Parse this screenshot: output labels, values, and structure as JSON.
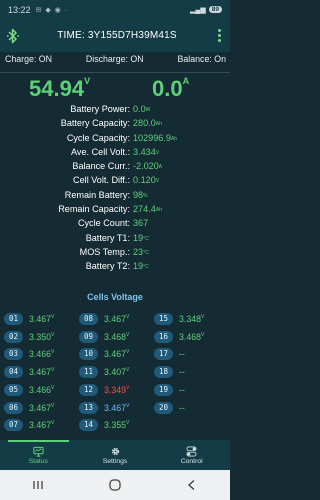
{
  "status_bar": {
    "time": "13:22",
    "battery": "89"
  },
  "app_bar": {
    "title": "TIME: 3Y155D7H39M41S"
  },
  "modes": {
    "charge_label": "Charge:",
    "charge_value": "ON",
    "discharge_label": "Discharge:",
    "discharge_value": "ON",
    "balance_label": "Balance:",
    "balance_value": "On"
  },
  "summary": {
    "voltage": "54.94",
    "voltage_unit": "V",
    "current": "0.0",
    "current_unit": "A"
  },
  "params": [
    {
      "label": "Battery Power:",
      "value": "0.0",
      "unit": "W"
    },
    {
      "label": "Battery Capacity:",
      "value": "280.0",
      "unit": "Ah"
    },
    {
      "label": "Cycle Capacity:",
      "value": "102996.9",
      "unit": "Ah"
    },
    {
      "label": "Ave. Cell Volt.:",
      "value": "3.434",
      "unit": "V"
    },
    {
      "label": "Balance Curr.:",
      "value": "-2.020",
      "unit": "A"
    },
    {
      "label": "Cell Volt. Diff.:",
      "value": "0.120",
      "unit": "V"
    },
    {
      "label": "Remain Battery:",
      "value": "98",
      "unit": "%"
    },
    {
      "label": "Remain Capacity:",
      "value": "274.4",
      "unit": "Ah"
    },
    {
      "label": "Cycle Count:",
      "value": "367",
      "unit": ""
    },
    {
      "label": "Battery T1:",
      "value": "19",
      "unit": "°C"
    },
    {
      "label": "MOS Temp.:",
      "value": "23",
      "unit": "°C"
    },
    {
      "label": "Battery T2:",
      "value": "19",
      "unit": "°C"
    }
  ],
  "cells_title": "Cells Voltage",
  "cells": [
    {
      "num": "01",
      "value": "3.467",
      "unit": "V",
      "tone": "green"
    },
    {
      "num": "02",
      "value": "3.350",
      "unit": "V",
      "tone": "green"
    },
    {
      "num": "03",
      "value": "3.466",
      "unit": "V",
      "tone": "green"
    },
    {
      "num": "04",
      "value": "3.467",
      "unit": "V",
      "tone": "green"
    },
    {
      "num": "05",
      "value": "3.466",
      "unit": "V",
      "tone": "green"
    },
    {
      "num": "06",
      "value": "3.467",
      "unit": "V",
      "tone": "green"
    },
    {
      "num": "07",
      "value": "3.467",
      "unit": "V",
      "tone": "green"
    },
    {
      "num": "08",
      "value": "3.467",
      "unit": "V",
      "tone": "green"
    },
    {
      "num": "09",
      "value": "3.468",
      "unit": "V",
      "tone": "green"
    },
    {
      "num": "10",
      "value": "3.467",
      "unit": "V",
      "tone": "green"
    },
    {
      "num": "11",
      "value": "3.407",
      "unit": "V",
      "tone": "green"
    },
    {
      "num": "12",
      "value": "3.349",
      "unit": "V",
      "tone": "red"
    },
    {
      "num": "13",
      "value": "3.467",
      "unit": "V",
      "tone": "blue"
    },
    {
      "num": "14",
      "value": "3.355",
      "unit": "V",
      "tone": "green"
    },
    {
      "num": "15",
      "value": "3.348",
      "unit": "V",
      "tone": "green"
    },
    {
      "num": "16",
      "value": "3.468",
      "unit": "V",
      "tone": "green"
    },
    {
      "num": "17",
      "value": "--",
      "unit": "",
      "tone": "na"
    },
    {
      "num": "18",
      "value": "--",
      "unit": "",
      "tone": "na"
    },
    {
      "num": "19",
      "value": "--",
      "unit": "",
      "tone": "na"
    },
    {
      "num": "20",
      "value": "--",
      "unit": "",
      "tone": "na"
    }
  ],
  "nav": {
    "tabs": [
      {
        "label": "Status",
        "icon": "monitor-icon",
        "active": true
      },
      {
        "label": "Settings",
        "icon": "gear-icon",
        "active": false
      },
      {
        "label": "Control",
        "icon": "toggle-icon",
        "active": false
      }
    ]
  },
  "colors": {
    "accent": "#5fd07a",
    "background": "#152b34",
    "bar": "#143c46",
    "cell_badge": "#1f5a7a",
    "low_cell": "#ff4b4b",
    "high_cell": "#6cb6ff"
  }
}
